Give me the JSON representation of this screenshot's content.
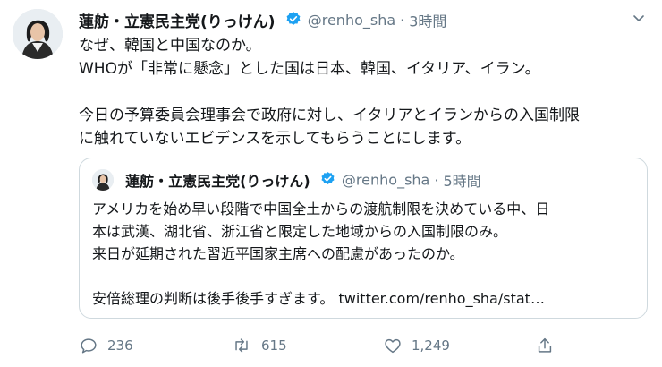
{
  "tweet": {
    "author_name": "蓮舫・立憲民主党(りっけん)",
    "handle": "@renho_sha",
    "separator": "·",
    "time": "3時間",
    "lines": [
      "なぜ、韓国と中国なのか。",
      "WHOが「非常に懸念」とした国は日本、韓国、イタリア、イラン。",
      "",
      "今日の予算委員会理事会で政府に対し、イタリアとイランからの入国制限",
      "に触れていないエビデンスを示してもらうことにします。"
    ]
  },
  "quoted": {
    "author_name": "蓮舫・立憲民主党(りっけん)",
    "handle": "@renho_sha",
    "separator": "·",
    "time": "5時間",
    "lines": [
      "アメリカを始め早い段階で中国全土からの渡航制限を決めている中、日",
      "本は武漢、湖北省、浙江省と限定した地域からの入国制限のみ。",
      "来日が延期された習近平国家主席への配慮があったのか。",
      "",
      "安倍総理の判断は後手後手すぎます。 twitter.com/renho_sha/stat…"
    ]
  },
  "actions": {
    "replies": "236",
    "retweets": "615",
    "likes": "1,249"
  },
  "colors": {
    "text": "#14171a",
    "muted": "#657786",
    "verified": "#1da1f2",
    "border": "#cfd9de"
  },
  "icons": {
    "verified": "verified-badge-icon",
    "caret": "chevron-down-icon",
    "reply": "reply-icon",
    "retweet": "retweet-icon",
    "like": "heart-icon",
    "share": "share-icon"
  }
}
